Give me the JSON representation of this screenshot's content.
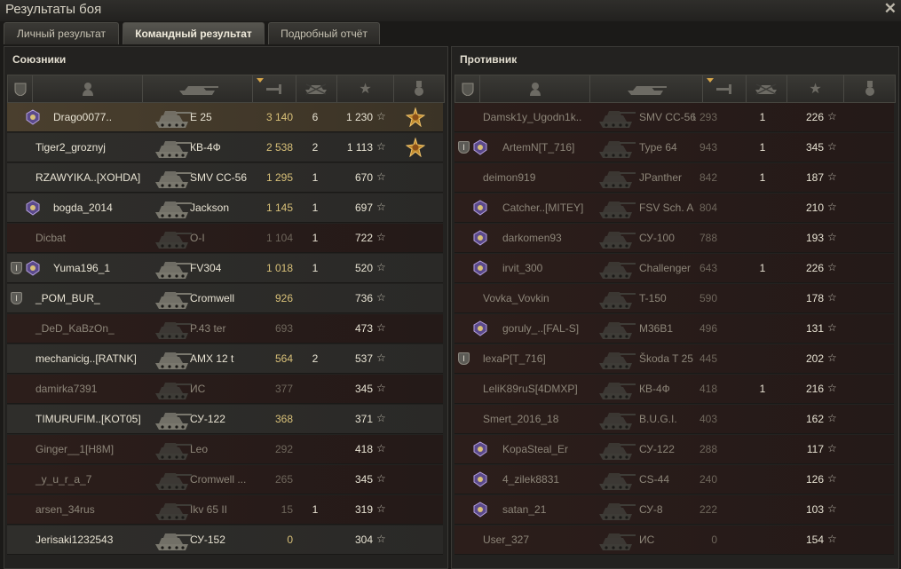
{
  "window": {
    "title": "Результаты боя",
    "close_icon": "close-icon"
  },
  "tabs": [
    {
      "label": "Личный результат",
      "active": false
    },
    {
      "label": "Командный результат",
      "active": true
    },
    {
      "label": "Подробный отчёт",
      "active": false
    }
  ],
  "allies": {
    "title": "Союзники",
    "rows": [
      {
        "squad": false,
        "clan": true,
        "name": "Drago0077..",
        "vehicle": "E 25",
        "damage": "3 140",
        "kills": "6",
        "xp": "1 230",
        "alive": true,
        "self": true,
        "medal": true
      },
      {
        "squad": false,
        "clan": false,
        "name": "Tiger2_groznyj",
        "vehicle": "КВ-4Ф",
        "damage": "2 538",
        "kills": "2",
        "xp": "1 113",
        "alive": true,
        "medal": true
      },
      {
        "squad": false,
        "clan": false,
        "name": "RZAWYIKA..[XOHDA]",
        "vehicle": "SMV CC-56",
        "damage": "1 295",
        "kills": "1",
        "xp": "670",
        "alive": true
      },
      {
        "squad": false,
        "clan": true,
        "name": "bogda_2014",
        "vehicle": "Jackson",
        "damage": "1 145",
        "kills": "1",
        "xp": "697",
        "alive": true
      },
      {
        "squad": false,
        "clan": false,
        "name": "Dicbat",
        "vehicle": "O-I",
        "damage": "1 104",
        "kills": "1",
        "xp": "722",
        "alive": false
      },
      {
        "squad": true,
        "clan": true,
        "name": "Yuma196_1",
        "vehicle": "FV304",
        "damage": "1 018",
        "kills": "1",
        "xp": "520",
        "alive": true
      },
      {
        "squad": true,
        "clan": false,
        "name": "_POM_BUR_",
        "vehicle": "Cromwell",
        "damage": "926",
        "kills": "",
        "xp": "736",
        "alive": true
      },
      {
        "squad": false,
        "clan": false,
        "name": "_DeD_KaBzOn_",
        "vehicle": "P.43 ter",
        "damage": "693",
        "kills": "",
        "xp": "473",
        "alive": false
      },
      {
        "squad": false,
        "clan": false,
        "name": "mechanicig..[RATNK]",
        "vehicle": "AMX 12 t",
        "damage": "564",
        "kills": "2",
        "xp": "537",
        "alive": true
      },
      {
        "squad": false,
        "clan": false,
        "name": "damirka7391",
        "vehicle": "ИС",
        "damage": "377",
        "kills": "",
        "xp": "345",
        "alive": false
      },
      {
        "squad": false,
        "clan": false,
        "name": "TIMURUFIM..[KOT05]",
        "vehicle": "СУ-122",
        "damage": "368",
        "kills": "",
        "xp": "371",
        "alive": true
      },
      {
        "squad": false,
        "clan": false,
        "name": "Ginger__1[H8M]",
        "vehicle": "Leo",
        "damage": "292",
        "kills": "",
        "xp": "418",
        "alive": false
      },
      {
        "squad": false,
        "clan": false,
        "name": "_y_u_r_a_7",
        "vehicle": "Cromwell ...",
        "damage": "265",
        "kills": "",
        "xp": "345",
        "alive": false
      },
      {
        "squad": false,
        "clan": false,
        "name": "arsen_34rus",
        "vehicle": "Ikv 65 II",
        "damage": "15",
        "kills": "1",
        "xp": "319",
        "alive": false
      },
      {
        "squad": false,
        "clan": false,
        "name": "Jerisaki1232543",
        "vehicle": "СУ-152",
        "damage": "0",
        "kills": "",
        "xp": "304",
        "alive": true
      }
    ]
  },
  "enemies": {
    "title": "Противник",
    "rows": [
      {
        "squad": false,
        "clan": false,
        "name": "Damsk1y_Ugodn1k..",
        "vehicle": "SMV CC-56",
        "damage": "1 293",
        "kills": "1",
        "xp": "226",
        "alive": false
      },
      {
        "squad": true,
        "clan": true,
        "name": "ArtemN[T_716]",
        "vehicle": "Type 64",
        "damage": "943",
        "kills": "1",
        "xp": "345",
        "alive": false
      },
      {
        "squad": false,
        "clan": false,
        "name": "deimon919",
        "vehicle": "JPanther",
        "damage": "842",
        "kills": "1",
        "xp": "187",
        "alive": false
      },
      {
        "squad": false,
        "clan": true,
        "name": "Catcher..[MITEY]",
        "vehicle": "FSV Sch. A",
        "damage": "804",
        "kills": "",
        "xp": "210",
        "alive": false
      },
      {
        "squad": false,
        "clan": true,
        "name": "darkomen93",
        "vehicle": "СУ-100",
        "damage": "788",
        "kills": "",
        "xp": "193",
        "alive": false
      },
      {
        "squad": false,
        "clan": true,
        "name": "irvit_300",
        "vehicle": "Challenger",
        "damage": "643",
        "kills": "1",
        "xp": "226",
        "alive": false
      },
      {
        "squad": false,
        "clan": false,
        "name": "Vovka_Vovkin",
        "vehicle": "T-150",
        "damage": "590",
        "kills": "",
        "xp": "178",
        "alive": false
      },
      {
        "squad": false,
        "clan": true,
        "name": "goruly_..[FAL-S]",
        "vehicle": "M36B1",
        "damage": "496",
        "kills": "",
        "xp": "131",
        "alive": false
      },
      {
        "squad": true,
        "clan": false,
        "name": "lexaP[T_716]",
        "vehicle": "Škoda T 25",
        "damage": "445",
        "kills": "",
        "xp": "202",
        "alive": false
      },
      {
        "squad": false,
        "clan": false,
        "name": "LeliK89ruS[4DMXP]",
        "vehicle": "КВ-4Ф",
        "damage": "418",
        "kills": "1",
        "xp": "216",
        "alive": false
      },
      {
        "squad": false,
        "clan": false,
        "name": "Smert_2016_18",
        "vehicle": "B.U.G.I.",
        "damage": "403",
        "kills": "",
        "xp": "162",
        "alive": false
      },
      {
        "squad": false,
        "clan": true,
        "name": "KopaSteal_Er",
        "vehicle": "СУ-122",
        "damage": "288",
        "kills": "",
        "xp": "117",
        "alive": false
      },
      {
        "squad": false,
        "clan": true,
        "name": "4_zilek8831",
        "vehicle": "CS-44",
        "damage": "240",
        "kills": "",
        "xp": "126",
        "alive": false
      },
      {
        "squad": false,
        "clan": true,
        "name": "satan_21",
        "vehicle": "СУ-8",
        "damage": "222",
        "kills": "",
        "xp": "103",
        "alive": false
      },
      {
        "squad": false,
        "clan": false,
        "name": "User_327",
        "vehicle": "ИС",
        "damage": "0",
        "kills": "",
        "xp": "154",
        "alive": false
      }
    ]
  },
  "columns": [
    "squad-icon",
    "player-icon",
    "tank-icon",
    "damage-icon",
    "kills-icon",
    "xp-star-icon",
    "medal-icon"
  ],
  "colors": {
    "alive_text": "#e8e3d3",
    "dead_text": "#8d8679",
    "damage": "#d8c078",
    "dead_bg": "#2a1c19"
  }
}
